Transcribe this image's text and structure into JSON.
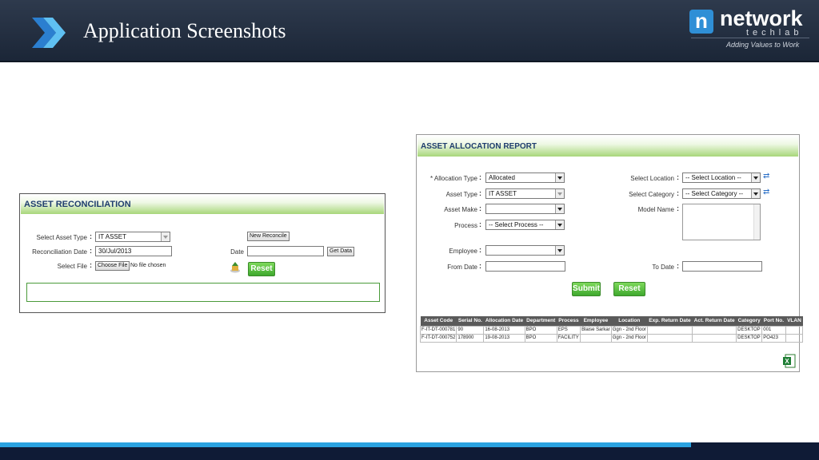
{
  "header": {
    "title": "Application Screenshots",
    "logo_letter": "n",
    "logo_name": "network",
    "logo_sub": "techlab",
    "logo_tagline": "Adding Values to Work"
  },
  "colors": {
    "accent_green": "#5cbf3f",
    "header_bg": "#1f2a3c",
    "footer_blue": "#2aa2e0",
    "title_blue": "#1f3d6e"
  },
  "reconciliation": {
    "title": "ASSET RECONCILIATION",
    "asset_type_label": "Select Asset Type",
    "asset_type_value": "IT ASSET",
    "recon_date_label": "Reconciliation Date",
    "recon_date_value": "30/Jul/2013",
    "select_file_label": "Select File",
    "choose_file_label": "Choose File",
    "no_file_text": "No file chosen",
    "new_reconcile_label": "New Reconcile",
    "date_label": "Date",
    "date_value": "",
    "get_data_label": "Get Data",
    "reset_label": "Reset"
  },
  "allocation": {
    "title": "ASSET ALLOCATION REPORT",
    "allocation_type_label": "* Allocation Type",
    "allocation_type_value": "Allocated",
    "asset_type_label": "Asset Type",
    "asset_type_value": "IT ASSET",
    "asset_make_label": "Asset Make",
    "asset_make_value": "",
    "process_label": "Process",
    "process_value": "-- Select Process --",
    "employee_label": "Employee",
    "employee_value": "",
    "from_date_label": "From Date",
    "select_location_label": "Select Location",
    "select_location_value": "-- Select Location --",
    "select_category_label": "Select Category",
    "select_category_value": "-- Select Category --",
    "model_name_label": "Model Name",
    "to_date_label": "To Date",
    "submit_label": "Submit",
    "reset_label": "Reset",
    "table": {
      "columns": [
        "Asset Code",
        "Serial No.",
        "Allocation Date",
        "Department",
        "Process",
        "Employee",
        "Location",
        "Exp. Return Date",
        "Act. Return Date",
        "Category",
        "Port No.",
        "VLAN"
      ],
      "rows": [
        [
          "F-IT-DT-000781",
          "90",
          "16-08-2013",
          "BPO",
          "EPS",
          "Blaise Sarkar",
          "Ggn - 2nd Floor",
          "",
          "",
          "DESKTOP",
          "001",
          ""
        ],
        [
          "F-IT-DT-000752",
          "178900",
          "19-08-2013",
          "BPO",
          "FACILITY",
          "",
          "Ggn - 2nd Floor",
          "",
          "",
          "DESKTOP",
          "PO423",
          ""
        ]
      ]
    },
    "excel_icon": "excel-export-icon"
  }
}
